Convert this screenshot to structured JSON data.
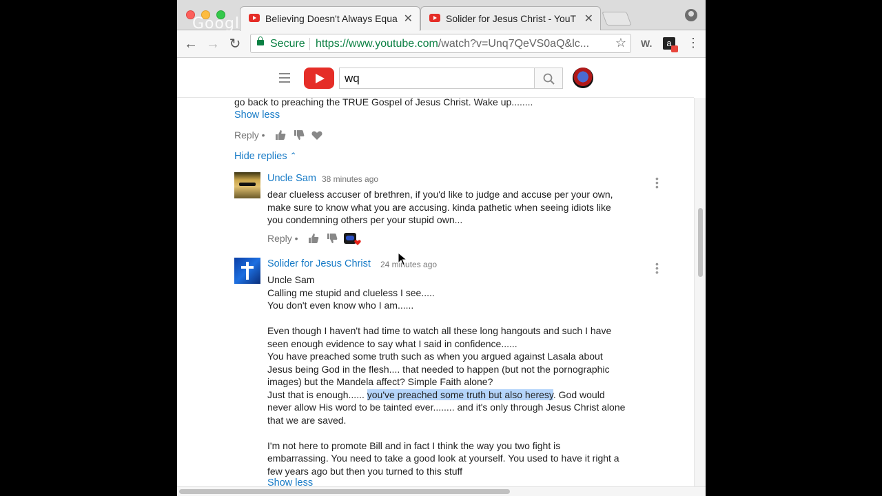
{
  "browser": {
    "tabs": [
      {
        "title": "Believing Doesn't Always Equa",
        "active": true
      },
      {
        "title": "Solider for Jesus Christ - YouT",
        "active": false
      }
    ],
    "secure_label": "Secure",
    "url_host": "https://www.youtube.com",
    "url_path": "/watch?v=Unq7QeVS0aQ&lc...",
    "watermark": "Google"
  },
  "youtube": {
    "search_value": "wq"
  },
  "comments": {
    "parent_tail": "go back to preaching the TRUE Gospel of Jesus Christ. Wake up........",
    "show_less": "Show less",
    "reply_label": "Reply",
    "hide_replies": "Hide replies",
    "replies": [
      {
        "author": "Uncle Sam",
        "time": "38 minutes ago",
        "lines": [
          "dear clueless accuser of brethren, if you'd like to judge and accuse per your own,",
          "make sure to know what you are accusing. kinda pathetic when seeing idiots like",
          "you condemning others per your stupid own..."
        ],
        "reply_label": "Reply"
      },
      {
        "author": "Solider for Jesus Christ",
        "time": "24 minutes ago",
        "lines": [
          "Uncle Sam",
          "Calling me stupid and clueless I see.....",
          "You don't even know who I am......",
          "",
          "Even though I haven't had time to watch all these long hangouts and such I have",
          "seen enough evidence to say what I said in confidence......",
          "You have preached some truth such as when you argued against Lasala about",
          "Jesus being God in the flesh.... that needed to happen (but not the pornographic",
          "images) but the Mandela affect? Simple Faith alone?"
        ],
        "line_hl_before": "Just that is enough...... ",
        "line_hl": "you've preached some truth but also heresy",
        "line_hl_after": ". God would",
        "lines_after": [
          "never allow His word to be tainted ever........ and it's only through Jesus Christ alone",
          "that we are saved.",
          "",
          "I'm not here to promote Bill and in fact I think the way you two fight is",
          "embarrassing. You need to take a good look at yourself. You used to have it right a",
          "few years ago but then you turned to this stuff"
        ],
        "show_less": "Show less"
      }
    ]
  },
  "colors": {
    "link": "#167ac6",
    "youtube_red": "#e52d27",
    "secure_green": "#0b8043",
    "highlight": "#b5d5fb"
  }
}
